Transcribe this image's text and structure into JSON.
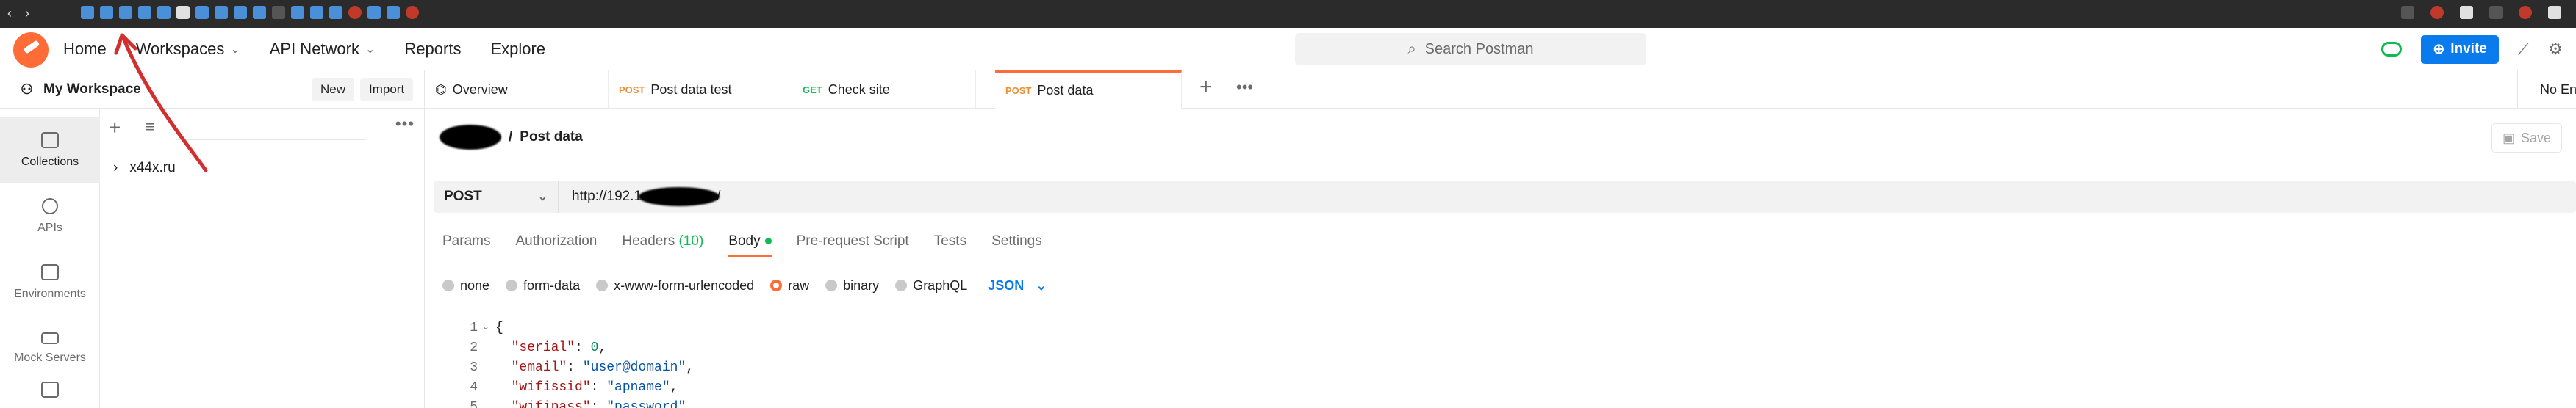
{
  "header": {
    "nav": [
      {
        "label": "Home"
      },
      {
        "label": "Workspaces"
      },
      {
        "label": "API Network"
      },
      {
        "label": "Reports"
      },
      {
        "label": "Explore"
      }
    ],
    "search_placeholder": "Search Postman",
    "invite_label": "Invite"
  },
  "sidebar": {
    "workspace_name": "My Workspace",
    "new_label": "New",
    "import_label": "Import",
    "rail": [
      {
        "label": "Collections",
        "icon": "collections-icon"
      },
      {
        "label": "APIs",
        "icon": "apis-icon"
      },
      {
        "label": "Environments",
        "icon": "environments-icon"
      },
      {
        "label": "Mock Servers",
        "icon": "mock-servers-icon"
      }
    ],
    "collection_name": "x44x.ru"
  },
  "tabs": [
    {
      "method": "",
      "label": "Overview"
    },
    {
      "method": "POST",
      "label": "Post data test"
    },
    {
      "method": "GET",
      "label": "Check site"
    },
    {
      "method": "POST",
      "label": "Post data"
    }
  ],
  "environment_label": "No Env",
  "request": {
    "title": "Post data",
    "save_label": "Save",
    "method": "POST",
    "url_visible": "http://192.1",
    "url_suffix": "/",
    "tabs": [
      {
        "label": "Params"
      },
      {
        "label": "Authorization"
      },
      {
        "label": "Headers",
        "count": "(10)"
      },
      {
        "label": "Body"
      },
      {
        "label": "Pre-request Script"
      },
      {
        "label": "Tests"
      },
      {
        "label": "Settings"
      }
    ],
    "body_types": [
      "none",
      "form-data",
      "x-www-form-urlencoded",
      "raw",
      "binary",
      "GraphQL"
    ],
    "selected_body_type": "raw",
    "format": "JSON"
  },
  "editor": {
    "line_numbers": [
      "1",
      "2",
      "3",
      "4",
      "5"
    ],
    "lines": [
      {
        "key": "\"serial\"",
        "value": "0",
        "type": "number"
      },
      {
        "key": "\"email\"",
        "value": "\"user@domain\"",
        "type": "string"
      },
      {
        "key": "\"wifissid\"",
        "value": "\"apname\"",
        "type": "string"
      },
      {
        "key": "\"wifipass\"",
        "value": "\"password\"",
        "type": "string"
      }
    ]
  },
  "colors": {
    "brand": "#ff6c37",
    "invite": "#097bed",
    "success": "#0cbb52",
    "annotation": "#d32f2f"
  }
}
